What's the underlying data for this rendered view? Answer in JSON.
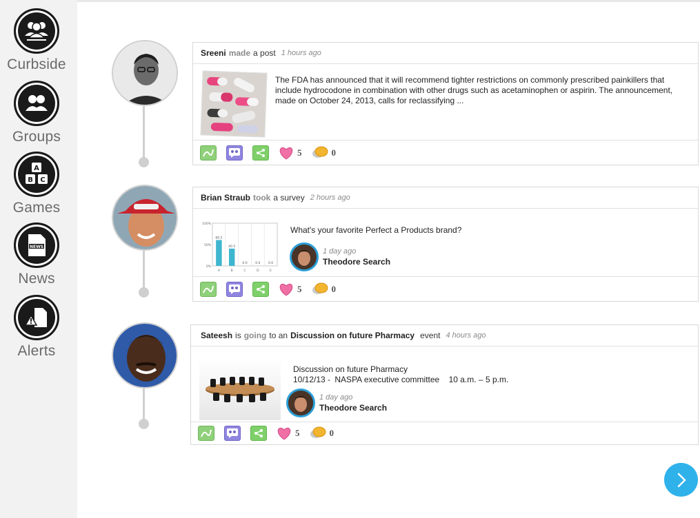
{
  "sidebar": {
    "items": [
      {
        "label": "Curbside",
        "icon": "group-icon"
      },
      {
        "label": "Groups",
        "icon": "people-icon"
      },
      {
        "label": "Games",
        "icon": "abc-blocks-icon"
      },
      {
        "label": "News",
        "icon": "news-icon"
      },
      {
        "label": "Alerts",
        "icon": "alert-icon"
      }
    ]
  },
  "feed": [
    {
      "actor": "Sreeni",
      "verb": "made",
      "object": "a post",
      "time": "1 hours ago",
      "body": "The FDA has announced that it will recommend tighter restrictions on commonly prescribed painkillers that include hydrocodone in combination with other drugs such as acetaminophen or aspirin. The announcement, made on October 24, 2013, calls for reclassifying ...",
      "likes": "5",
      "comments": "0"
    },
    {
      "actor": "Brian Straub",
      "verb": "took",
      "object": "a survey",
      "time": "2 hours ago",
      "question": "What's your favorite Perfect a Products brand?",
      "sub_time": "1 day ago",
      "sub_user": "Theodore Search",
      "likes": "5",
      "comments": "0"
    },
    {
      "actor": "Sateesh",
      "connector": "is",
      "verb": "going",
      "connector2": "to an",
      "event": "Discussion on future Pharmacy",
      "object": "event",
      "time": "4 hours ago",
      "event_title": "Discussion on future Pharmacy",
      "event_date": "10/12/13 -",
      "event_org": "NASPA executive committee",
      "event_time": "10 a.m. – 5 p.m.",
      "sub_time": "1 day ago",
      "sub_user": "Theodore Search",
      "likes": "5",
      "comments": "0"
    }
  ],
  "chart_data": {
    "type": "bar",
    "categories": [
      "A",
      "B",
      "C",
      "D",
      "E"
    ],
    "values": [
      60.5,
      40.5,
      0.0,
      0.0,
      0.0
    ],
    "value_labels": [
      "60.5",
      "40.5",
      "0.0",
      "0.0",
      "0.0"
    ],
    "yticks": [
      "100%",
      "50%",
      "0%"
    ],
    "ylim": [
      0,
      100
    ],
    "bar_color": "#3fb6cf"
  },
  "colors": {
    "accent": "#2fb1ea",
    "sidebar_bg": "#f2f2f2"
  }
}
